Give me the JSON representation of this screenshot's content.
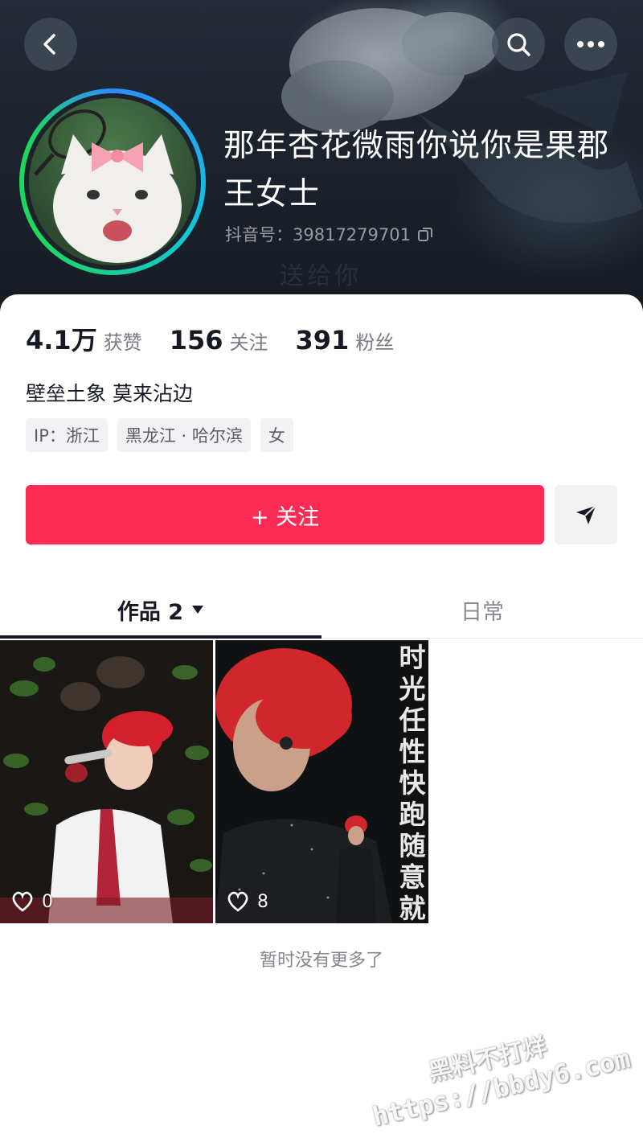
{
  "header": {
    "background_text": "送给你",
    "back_icon": "chevron-left-icon",
    "search_icon": "search-icon",
    "more_icon": "more-dots-icon"
  },
  "profile": {
    "name": "那年杏花微雨你说你是果郡王女士",
    "douyin_id": "抖音号：39817279701",
    "copy_icon": "copy-icon"
  },
  "stats": [
    {
      "value": "4.1万",
      "label": "获赞"
    },
    {
      "value": "156",
      "label": "关注"
    },
    {
      "value": "391",
      "label": "粉丝"
    }
  ],
  "bio": "壁垒土象 莫来沾边",
  "tags": [
    "IP：浙江",
    "黑龙江 · 哈尔滨",
    "女"
  ],
  "actions": {
    "follow_label": "+ 关注",
    "share_icon": "send-icon"
  },
  "tabs": [
    {
      "label": "作品 2",
      "active": true
    },
    {
      "label": "日常",
      "active": false
    }
  ],
  "videos": [
    {
      "likes": "0",
      "overlay_text": ""
    },
    {
      "likes": "8",
      "overlay_text": "时光任性快跑随意就转"
    }
  ],
  "footer": {
    "no_more_text": "暂时没有更多了"
  },
  "watermark": {
    "line1": "黑料不打烊",
    "line2": "https://bbdy6.com"
  },
  "colors": {
    "accent": "#fe2c55",
    "avatar_ring": [
      "#2f8cff",
      "#1ed760"
    ]
  }
}
